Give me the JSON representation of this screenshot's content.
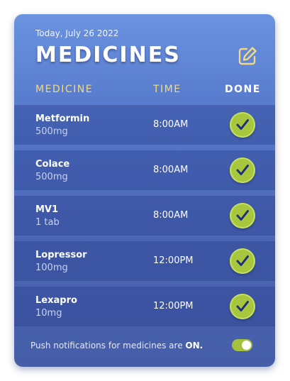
{
  "header": {
    "date": "Today, July 26 2022",
    "title": "MEDICINES"
  },
  "columns": {
    "medicine": "MEDICINE",
    "time": "TIME",
    "done": "DONE"
  },
  "medicines": [
    {
      "name": "Metformin",
      "dose": "500mg",
      "time": "8:00AM",
      "done": true
    },
    {
      "name": "Colace",
      "dose": "500mg",
      "time": "8:00AM",
      "done": true
    },
    {
      "name": "MV1",
      "dose": "1 tab",
      "time": "8:00AM",
      "done": true
    },
    {
      "name": "Lopressor",
      "dose": "100mg",
      "time": "12:00PM",
      "done": true
    },
    {
      "name": "Lexapro",
      "dose": "10mg",
      "time": "12:00PM",
      "done": true
    }
  ],
  "footer": {
    "notification_text": "Push notifications for medicines are",
    "notification_state": "ON.",
    "toggle_on": true
  },
  "colors": {
    "accent_yellow": "#f2d982",
    "check_green": "#a7c83e",
    "card_top": "#6a93e0",
    "card_bottom": "#465ea8"
  },
  "icons": {
    "edit": "edit-icon",
    "check": "check-icon"
  }
}
